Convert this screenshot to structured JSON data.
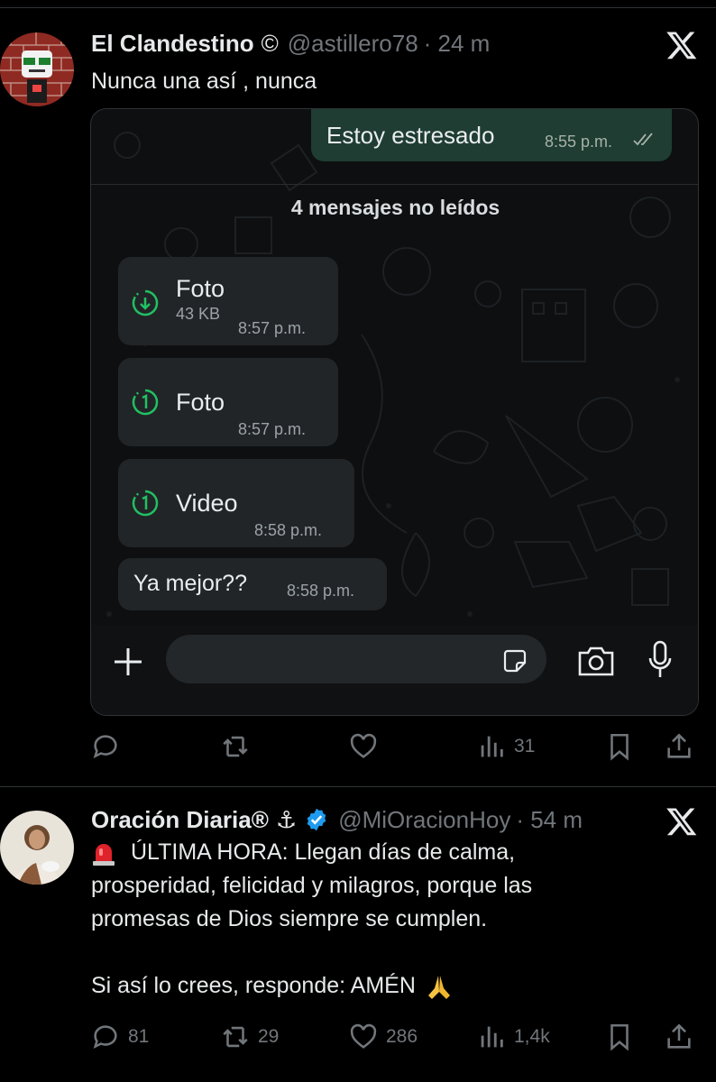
{
  "tweets": [
    {
      "name": "El Clandestino",
      "name_suffix": "©",
      "handle": "@astillero78",
      "time": "· 24 m",
      "text": "Nunca una así , nunca",
      "media": {
        "outgoing": {
          "text": "Estoy estresado",
          "time": "8:55 p.m."
        },
        "unread_label": "4 mensajes no leídos",
        "incoming": [
          {
            "label": "Foto",
            "size": "43 KB",
            "time": "8:57 p.m.",
            "icon": "download-icon"
          },
          {
            "label": "Foto",
            "size": "",
            "time": "8:57 p.m.",
            "icon": "view-once-icon"
          },
          {
            "label": "Video",
            "size": "",
            "time": "8:58 p.m.",
            "icon": "view-once-icon"
          },
          {
            "label": "Ya mejor??",
            "size": "",
            "time": "8:58 p.m.",
            "icon": ""
          }
        ]
      },
      "stats": {
        "replies": "",
        "retweets": "",
        "likes": "",
        "views": "31"
      }
    },
    {
      "name": "Oración Diaria®",
      "name_suffix": "⚓",
      "handle": "@MiOracionHoy",
      "time": "· 54 m",
      "text_line1": "ÚLTIMA HORA: Llegan días de calma,",
      "text_line2": "prosperidad, felicidad y milagros, porque las",
      "text_line3": "promesas de Dios siempre se cumplen.",
      "text_line4": "Si así lo crees, responde: AMÉN",
      "stats": {
        "replies": "81",
        "retweets": "29",
        "likes": "286",
        "views": "1,4k"
      }
    }
  ],
  "colors": {
    "background": "#000000",
    "text": "#e7e9ea",
    "muted": "#71767b",
    "verified": "#1d9bf0",
    "wa_out": "#1f3d32",
    "wa_in": "#222527"
  }
}
